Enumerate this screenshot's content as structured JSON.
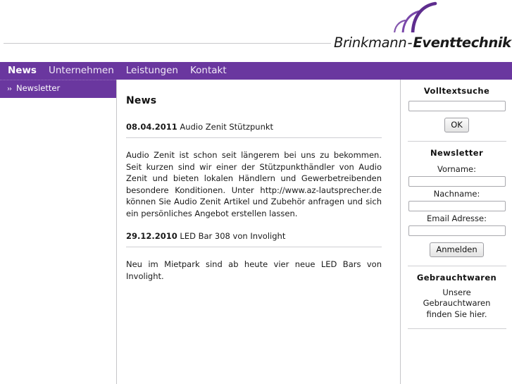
{
  "header": {
    "logo": {
      "brand": "Brinkmann",
      "separator": "-",
      "suffix": "Eventtechnik",
      "arcs_icon": "sound-wave-arcs-icon",
      "accent_color": "#6a379f"
    }
  },
  "nav": {
    "items": [
      {
        "label": "News",
        "active": true
      },
      {
        "label": "Unternehmen",
        "active": false
      },
      {
        "label": "Leistungen",
        "active": false
      },
      {
        "label": "Kontakt",
        "active": false
      }
    ]
  },
  "sidebar_left": {
    "items": [
      {
        "label": "Newsletter",
        "chevron": "››"
      }
    ]
  },
  "main": {
    "title": "News",
    "articles": [
      {
        "date": "08.04.2011",
        "headline": "Audio Zenit Stützpunkt",
        "body": "Audio Zenit ist schon seit längerem bei uns zu bekommen. Seit kurzen sind wir einer der Stützpunkthändler von Audio Zenit und bieten lokalen Händlern und Gewerbetreibenden besondere Konditionen. Unter http://www.az-lautsprecher.de können Sie Audio Zenit Artikel und Zubehör anfragen und sich ein persönliches Angebot erstellen lassen."
      },
      {
        "date": "29.12.2010",
        "headline": "LED Bar 308 von Involight",
        "body": "Neu im Mietpark sind ab heute vier neue LED Bars von Involight."
      }
    ]
  },
  "sidebar_right": {
    "search": {
      "title": "Volltextsuche",
      "value": "",
      "placeholder": "",
      "button_label": "OK"
    },
    "newsletter": {
      "title": "Newsletter",
      "firstname_label": "Vorname:",
      "firstname_value": "",
      "lastname_label": "Nachname:",
      "lastname_value": "",
      "email_label": "Email Adresse:",
      "email_value": "",
      "button_label": "Anmelden"
    },
    "used_goods": {
      "title": "Gebrauchtwaren",
      "line1": "Unsere Gebrauchtwaren",
      "line2": "finden Sie hier."
    }
  }
}
